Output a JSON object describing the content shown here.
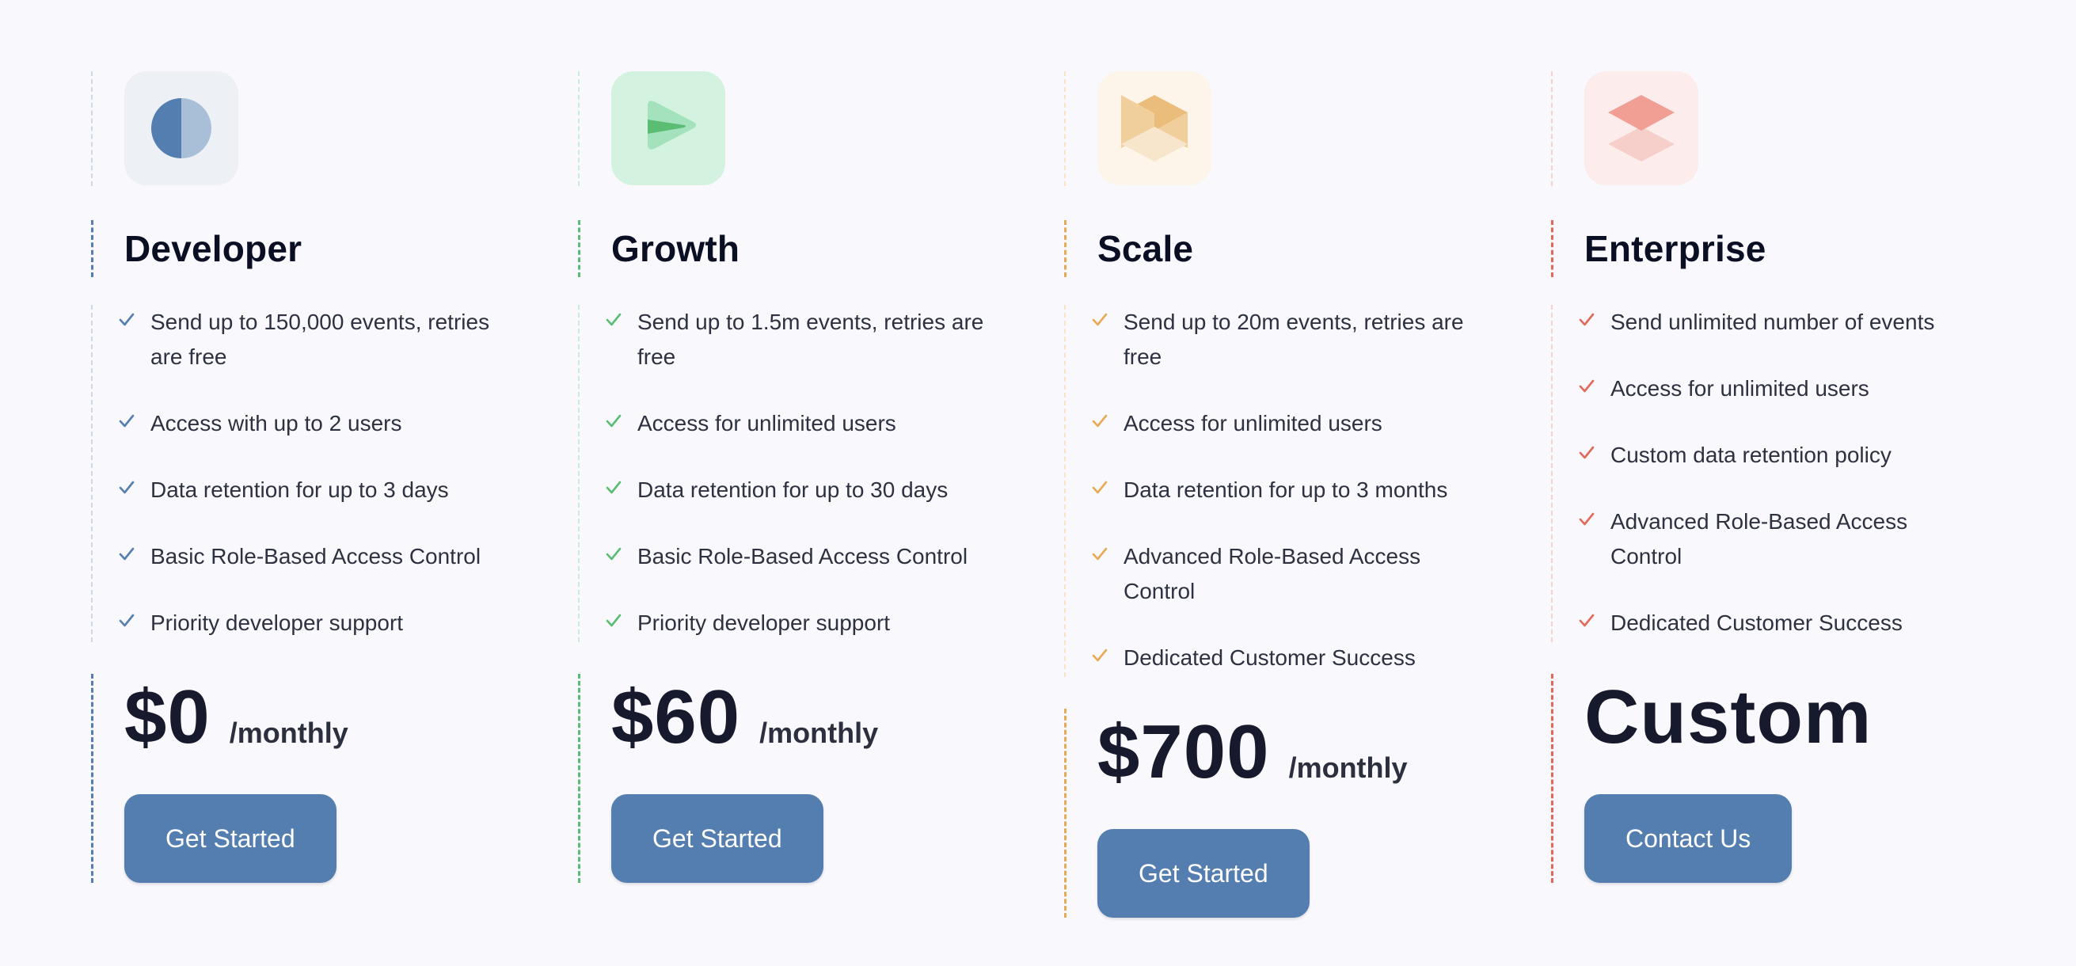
{
  "plans": [
    {
      "id": "developer",
      "icon": "half-circle-icon",
      "name": "Developer",
      "accent": "#537eaf",
      "soft": "#cdd9e6",
      "tint": "#edf1f6",
      "features": [
        "Send up to 150,000 events, retries are free",
        "Access with up to 2 users",
        "Data retention for up to 3 days",
        "Basic Role-Based Access Control",
        "Priority developer support"
      ],
      "price": "$0",
      "period": "/monthly",
      "cta": "Get Started"
    },
    {
      "id": "growth",
      "icon": "paper-plane-icon",
      "name": "Growth",
      "accent": "#5bbd74",
      "soft": "#c9ecd7",
      "tint": "#d3f3e0",
      "features": [
        "Send up to 1.5m events, retries are free",
        "Access for unlimited users",
        "Data retention for up to 30 days",
        "Basic Role-Based Access Control",
        "Priority developer support"
      ],
      "price": "$60",
      "period": "/monthly",
      "cta": "Get Started"
    },
    {
      "id": "scale",
      "icon": "cube-icon",
      "name": "Scale",
      "accent": "#e8ab55",
      "soft": "#f8e3c7",
      "tint": "#fdf5ea",
      "features": [
        "Send up to 20m events, retries are free",
        "Access for unlimited users",
        "Data retention for up to 3 months",
        "Advanced Role-Based Access Control",
        "Dedicated Customer Success"
      ],
      "price": "$700",
      "period": "/monthly",
      "cta": "Get Started"
    },
    {
      "id": "enterprise",
      "icon": "layers-icon",
      "name": "Enterprise",
      "accent": "#e3685a",
      "soft": "#f6d0cb",
      "tint": "#fcecec",
      "features": [
        "Send unlimited number of events",
        "Access for unlimited users",
        "Custom data retention policy",
        "Advanced Role-Based Access Control",
        "Dedicated Customer Success"
      ],
      "price": "Custom",
      "period": "",
      "cta": "Contact Us"
    }
  ]
}
